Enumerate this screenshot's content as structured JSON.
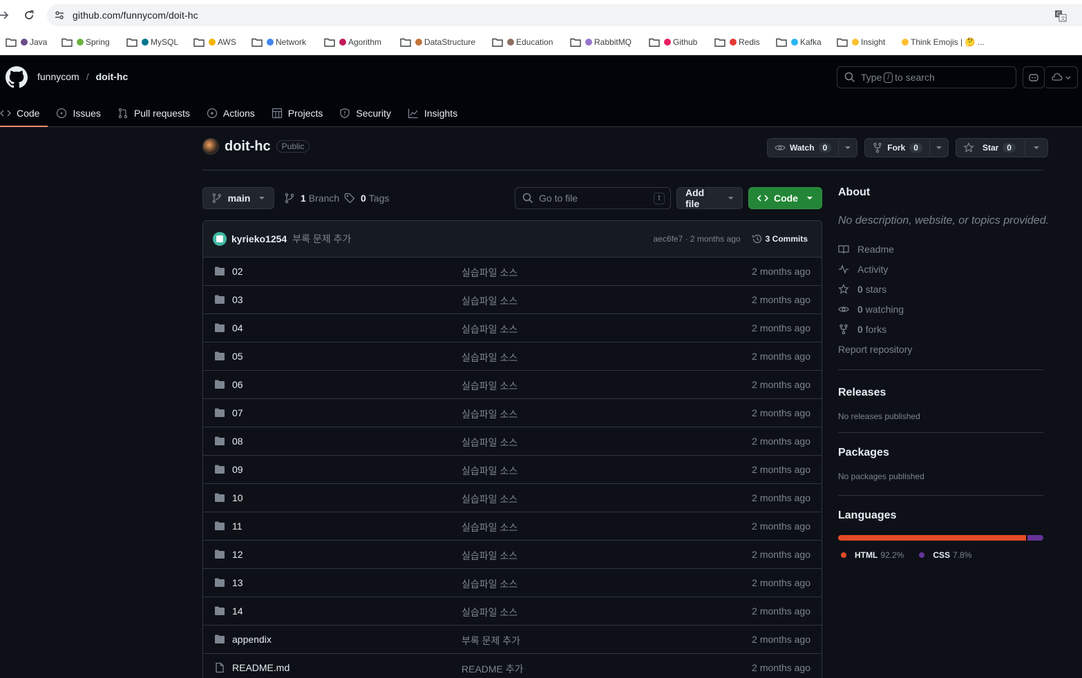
{
  "browser": {
    "url": "github.com/funnycom/doit-hc",
    "bookmarks": [
      {
        "label": "Java",
        "folder": true,
        "dot": "#6b4c8a"
      },
      {
        "label": "Spring",
        "folder": true,
        "dot": "#6db33f"
      },
      {
        "label": "MySQL",
        "folder": true,
        "dot": "#00758f"
      },
      {
        "label": "AWS",
        "folder": true,
        "dot": "#f4b400"
      },
      {
        "label": "Network",
        "folder": true,
        "dot": "#4285f4"
      },
      {
        "label": "Agorithm",
        "folder": true,
        "dot": "#c2185b"
      },
      {
        "label": "DataStructure",
        "folder": true,
        "dot": "#c4733b"
      },
      {
        "label": "Education",
        "folder": true,
        "dot": "#8d6e63"
      },
      {
        "label": "RabbitMQ",
        "folder": true,
        "dot": "#9575cd"
      },
      {
        "label": "Github",
        "folder": true,
        "dot": "#e91e63"
      },
      {
        "label": "Redis",
        "folder": true,
        "dot": "#e53935"
      },
      {
        "label": "Kafka",
        "folder": true,
        "dot": "#29b6f6"
      },
      {
        "label": "Insight",
        "folder": true,
        "dot": "#fbc02d"
      },
      {
        "label": "Think Emojis | 🤔 ...",
        "folder": false,
        "dot": "#fbc02d"
      }
    ]
  },
  "header": {
    "owner": "funnycom",
    "separator": "/",
    "repo": "doit-hc",
    "search_prefix": "Type",
    "search_key": "/",
    "search_suffix": "to search"
  },
  "tabs": [
    {
      "label": "Code",
      "icon": "code-icon",
      "active": true
    },
    {
      "label": "Issues",
      "icon": "issue-icon",
      "active": false
    },
    {
      "label": "Pull requests",
      "icon": "pull-request-icon",
      "active": false
    },
    {
      "label": "Actions",
      "icon": "play-icon",
      "active": false
    },
    {
      "label": "Projects",
      "icon": "table-icon",
      "active": false
    },
    {
      "label": "Security",
      "icon": "shield-icon",
      "active": false
    },
    {
      "label": "Insights",
      "icon": "graph-icon",
      "active": false
    }
  ],
  "repo": {
    "name": "doit-hc",
    "visibility": "Public",
    "watch_label": "Watch",
    "watch_count": "0",
    "fork_label": "Fork",
    "fork_count": "0",
    "star_label": "Star",
    "star_count": "0"
  },
  "toolbar": {
    "branch": "main",
    "branch_count": "1",
    "branch_label": "Branch",
    "tag_count": "0",
    "tag_label": "Tags",
    "goto_placeholder": "Go to file",
    "goto_key": "t",
    "add_file": "Add file",
    "code": "Code"
  },
  "commit": {
    "user": "kyrieko1254",
    "message": "부록 문제 추가",
    "hash_time": "aec6fe7 · 2 months ago",
    "commits_label": "3 Commits"
  },
  "files": [
    {
      "name": "02",
      "type": "dir",
      "message": "실습파일 소스",
      "date": "2 months ago"
    },
    {
      "name": "03",
      "type": "dir",
      "message": "실습파일 소스",
      "date": "2 months ago"
    },
    {
      "name": "04",
      "type": "dir",
      "message": "실습파일 소스",
      "date": "2 months ago"
    },
    {
      "name": "05",
      "type": "dir",
      "message": "실습파일 소스",
      "date": "2 months ago"
    },
    {
      "name": "06",
      "type": "dir",
      "message": "실습파일 소스",
      "date": "2 months ago"
    },
    {
      "name": "07",
      "type": "dir",
      "message": "실습파일 소스",
      "date": "2 months ago"
    },
    {
      "name": "08",
      "type": "dir",
      "message": "실습파일 소스",
      "date": "2 months ago"
    },
    {
      "name": "09",
      "type": "dir",
      "message": "실습파일 소스",
      "date": "2 months ago"
    },
    {
      "name": "10",
      "type": "dir",
      "message": "실습파일 소스",
      "date": "2 months ago"
    },
    {
      "name": "11",
      "type": "dir",
      "message": "실습파일 소스",
      "date": "2 months ago"
    },
    {
      "name": "12",
      "type": "dir",
      "message": "실습파일 소스",
      "date": "2 months ago"
    },
    {
      "name": "13",
      "type": "dir",
      "message": "실습파일 소스",
      "date": "2 months ago"
    },
    {
      "name": "14",
      "type": "dir",
      "message": "실습파일 소스",
      "date": "2 months ago"
    },
    {
      "name": "appendix",
      "type": "dir",
      "message": "부록 문제 추가",
      "date": "2 months ago"
    },
    {
      "name": "README.md",
      "type": "file",
      "message": "README 추가",
      "date": "2 months ago"
    }
  ],
  "about": {
    "title": "About",
    "description": "No description, website, or topics provided.",
    "readme": "Readme",
    "activity": "Activity",
    "stars_count": "0",
    "stars_label": "stars",
    "watching_count": "0",
    "watching_label": "watching",
    "forks_count": "0",
    "forks_label": "forks",
    "report": "Report repository"
  },
  "releases": {
    "title": "Releases",
    "text": "No releases published"
  },
  "packages": {
    "title": "Packages",
    "text": "No packages published"
  },
  "languages": {
    "title": "Languages",
    "items": [
      {
        "name": "HTML",
        "percent": "92.2%",
        "value": 92.2,
        "color": "#e34c26"
      },
      {
        "name": "CSS",
        "percent": "7.8%",
        "value": 7.8,
        "color": "#663399"
      }
    ]
  },
  "colors": {
    "accent_green": "#238636",
    "tab_underline": "#fd8c73",
    "bg": "#0d1117"
  }
}
